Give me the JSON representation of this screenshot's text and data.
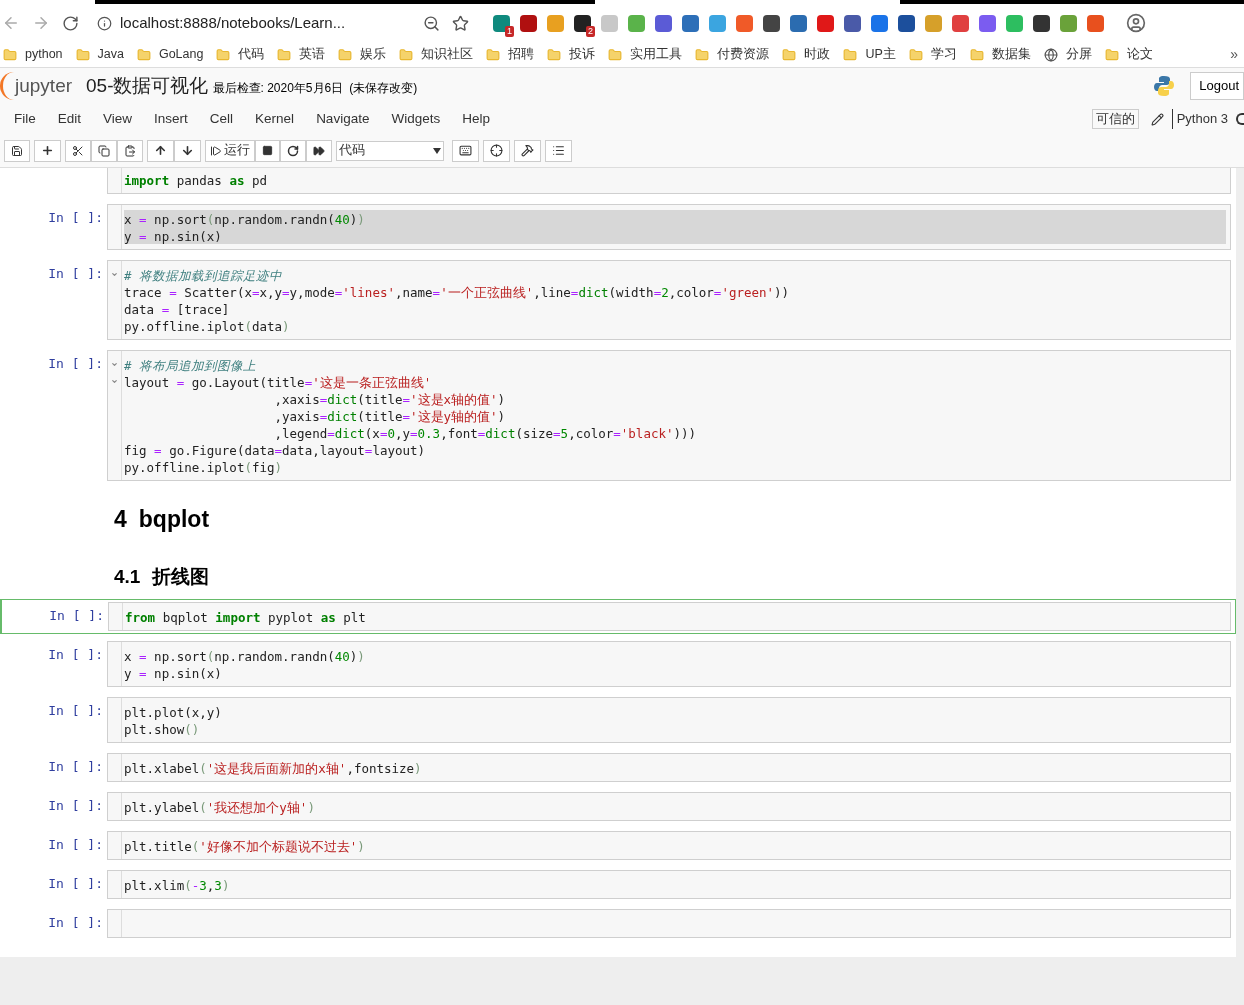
{
  "browser": {
    "url": "localhost:8888/notebooks/Learn...",
    "extensions": [
      {
        "color": "#0f8a7e",
        "badge": "1"
      },
      {
        "color": "#b01010"
      },
      {
        "color": "#e8a020"
      },
      {
        "color": "#222222",
        "badge": "2"
      },
      {
        "color": "#c8c8c8"
      },
      {
        "color": "#5ab34a"
      },
      {
        "color": "#5b5bd6"
      },
      {
        "color": "#2d6fb8"
      },
      {
        "color": "#3ba5e0"
      },
      {
        "color": "#f05a28"
      },
      {
        "color": "#444444"
      },
      {
        "color": "#2b6cb0"
      },
      {
        "color": "#e01818"
      },
      {
        "color": "#4a5aa8"
      },
      {
        "color": "#1a73e8"
      },
      {
        "color": "#1c4f9c"
      },
      {
        "color": "#d6a02a"
      },
      {
        "color": "#e04040"
      },
      {
        "color": "#7b5cf0"
      },
      {
        "color": "#2dbe60"
      },
      {
        "color": "#333333"
      },
      {
        "color": "#6aa23a"
      },
      {
        "color": "#e8501e"
      }
    ],
    "bookmarks": [
      {
        "kind": "folder",
        "label": "python"
      },
      {
        "kind": "folder",
        "label": "Java"
      },
      {
        "kind": "folder",
        "label": "GoLang"
      },
      {
        "kind": "folder",
        "label": "代码"
      },
      {
        "kind": "folder",
        "label": "英语"
      },
      {
        "kind": "folder",
        "label": "娱乐"
      },
      {
        "kind": "folder",
        "label": "知识社区"
      },
      {
        "kind": "folder",
        "label": "招聘"
      },
      {
        "kind": "folder",
        "label": "投诉"
      },
      {
        "kind": "folder",
        "label": "实用工具"
      },
      {
        "kind": "folder",
        "label": "付费资源"
      },
      {
        "kind": "folder",
        "label": "时政"
      },
      {
        "kind": "folder",
        "label": "UP主"
      },
      {
        "kind": "folder",
        "label": "学习"
      },
      {
        "kind": "folder",
        "label": "数据集"
      },
      {
        "kind": "site",
        "label": "分屏"
      },
      {
        "kind": "folder",
        "label": "论文"
      }
    ],
    "more": "»"
  },
  "header": {
    "logo": "jupyter",
    "title": "05-数据可视化",
    "checkpoint": "最后检查: 2020年5月6日",
    "save_status": "(未保存改变)",
    "logout": "Logout"
  },
  "menu": [
    "File",
    "Edit",
    "View",
    "Insert",
    "Cell",
    "Kernel",
    "Navigate",
    "Widgets",
    "Help"
  ],
  "status": {
    "trusted": "可信的",
    "kernel": "Python 3"
  },
  "toolbar": {
    "run_label": "运行",
    "cell_type": "代码"
  },
  "cells": [
    {
      "kind": "code",
      "selected": false,
      "text_selected": false,
      "lines": [
        {
          "fold": false,
          "segs": [
            {
              "kind": "keyword",
              "text": "import"
            },
            {
              "kind": "plain",
              "text": " pandas "
            },
            {
              "kind": "keyword",
              "text": "as"
            },
            {
              "kind": "plain",
              "text": " pd"
            }
          ]
        }
      ]
    },
    {
      "kind": "code",
      "prompt": "In [ ]:",
      "selected": false,
      "text_selected": true,
      "lines": [
        {
          "fold": false,
          "segs": [
            {
              "kind": "plain",
              "text": "x "
            },
            {
              "kind": "operator",
              "text": "="
            },
            {
              "kind": "plain",
              "text": " np.sort"
            },
            {
              "kind": "bracket",
              "text": "("
            },
            {
              "kind": "plain",
              "text": "np.random.randn("
            },
            {
              "kind": "number",
              "text": "40"
            },
            {
              "kind": "plain",
              "text": ")"
            },
            {
              "kind": "bracket",
              "text": ")"
            }
          ]
        },
        {
          "fold": false,
          "segs": [
            {
              "kind": "plain",
              "text": "y "
            },
            {
              "kind": "operator",
              "text": "="
            },
            {
              "kind": "plain",
              "text": " np.sin(x)"
            }
          ]
        }
      ]
    },
    {
      "kind": "code",
      "prompt": "In [ ]:",
      "selected": false,
      "text_selected": false,
      "lines": [
        {
          "fold": true,
          "segs": [
            {
              "kind": "comment",
              "text": "# 将数据加载到追踪足迹中"
            }
          ]
        },
        {
          "fold": false,
          "segs": [
            {
              "kind": "plain",
              "text": "trace "
            },
            {
              "kind": "operator",
              "text": "="
            },
            {
              "kind": "plain",
              "text": " Scatter(x"
            },
            {
              "kind": "operator",
              "text": "="
            },
            {
              "kind": "plain",
              "text": "x,y"
            },
            {
              "kind": "operator",
              "text": "="
            },
            {
              "kind": "plain",
              "text": "y,mode"
            },
            {
              "kind": "operator",
              "text": "="
            },
            {
              "kind": "string",
              "text": "'lines'"
            },
            {
              "kind": "plain",
              "text": ",name"
            },
            {
              "kind": "operator",
              "text": "="
            },
            {
              "kind": "string",
              "text": "'一个正弦曲线'"
            },
            {
              "kind": "plain",
              "text": ",line"
            },
            {
              "kind": "operator",
              "text": "="
            },
            {
              "kind": "builtin",
              "text": "dict"
            },
            {
              "kind": "plain",
              "text": "(width"
            },
            {
              "kind": "operator",
              "text": "="
            },
            {
              "kind": "number",
              "text": "2"
            },
            {
              "kind": "plain",
              "text": ",color"
            },
            {
              "kind": "operator",
              "text": "="
            },
            {
              "kind": "string",
              "text": "'green'"
            },
            {
              "kind": "plain",
              "text": "))"
            }
          ]
        },
        {
          "fold": false,
          "segs": [
            {
              "kind": "plain",
              "text": "data "
            },
            {
              "kind": "operator",
              "text": "="
            },
            {
              "kind": "plain",
              "text": " [trace]"
            }
          ]
        },
        {
          "fold": false,
          "segs": [
            {
              "kind": "plain",
              "text": "py.offline.iplot"
            },
            {
              "kind": "bracket",
              "text": "("
            },
            {
              "kind": "plain",
              "text": "data"
            },
            {
              "kind": "bracket",
              "text": ")"
            }
          ]
        }
      ]
    },
    {
      "kind": "code",
      "prompt": "In [ ]:",
      "selected": false,
      "text_selected": false,
      "lines": [
        {
          "fold": true,
          "segs": [
            {
              "kind": "comment",
              "text": "# 将布局追加到图像上"
            }
          ]
        },
        {
          "fold": true,
          "segs": [
            {
              "kind": "plain",
              "text": "layout "
            },
            {
              "kind": "operator",
              "text": "="
            },
            {
              "kind": "plain",
              "text": " go.Layout(title"
            },
            {
              "kind": "operator",
              "text": "="
            },
            {
              "kind": "string",
              "text": "'这是一条正弦曲线'"
            }
          ]
        },
        {
          "fold": false,
          "segs": [
            {
              "kind": "plain",
              "text": "                    ,xaxis"
            },
            {
              "kind": "operator",
              "text": "="
            },
            {
              "kind": "builtin",
              "text": "dict"
            },
            {
              "kind": "plain",
              "text": "(title"
            },
            {
              "kind": "operator",
              "text": "="
            },
            {
              "kind": "string",
              "text": "'这是x轴的值'"
            },
            {
              "kind": "plain",
              "text": ")"
            }
          ]
        },
        {
          "fold": false,
          "segs": [
            {
              "kind": "plain",
              "text": "                    ,yaxis"
            },
            {
              "kind": "operator",
              "text": "="
            },
            {
              "kind": "builtin",
              "text": "dict"
            },
            {
              "kind": "plain",
              "text": "(title"
            },
            {
              "kind": "operator",
              "text": "="
            },
            {
              "kind": "string",
              "text": "'这是y轴的值'"
            },
            {
              "kind": "plain",
              "text": ")"
            }
          ]
        },
        {
          "fold": false,
          "segs": [
            {
              "kind": "plain",
              "text": "                    ,legend"
            },
            {
              "kind": "operator",
              "text": "="
            },
            {
              "kind": "builtin",
              "text": "dict"
            },
            {
              "kind": "plain",
              "text": "(x"
            },
            {
              "kind": "operator",
              "text": "="
            },
            {
              "kind": "number",
              "text": "0"
            },
            {
              "kind": "plain",
              "text": ",y"
            },
            {
              "kind": "operator",
              "text": "="
            },
            {
              "kind": "number",
              "text": "0.3"
            },
            {
              "kind": "plain",
              "text": ",font"
            },
            {
              "kind": "operator",
              "text": "="
            },
            {
              "kind": "builtin",
              "text": "dict"
            },
            {
              "kind": "plain",
              "text": "(size"
            },
            {
              "kind": "operator",
              "text": "="
            },
            {
              "kind": "number",
              "text": "5"
            },
            {
              "kind": "plain",
              "text": ",color"
            },
            {
              "kind": "operator",
              "text": "="
            },
            {
              "kind": "string",
              "text": "'black'"
            },
            {
              "kind": "plain",
              "text": ")))"
            }
          ]
        },
        {
          "fold": false,
          "segs": [
            {
              "kind": "plain",
              "text": "fig "
            },
            {
              "kind": "operator",
              "text": "="
            },
            {
              "kind": "plain",
              "text": " go.Figure(data"
            },
            {
              "kind": "operator",
              "text": "="
            },
            {
              "kind": "plain",
              "text": "data,layout"
            },
            {
              "kind": "operator",
              "text": "="
            },
            {
              "kind": "plain",
              "text": "layout)"
            }
          ]
        },
        {
          "fold": false,
          "segs": [
            {
              "kind": "plain",
              "text": "py.offline.iplot"
            },
            {
              "kind": "bracket",
              "text": "("
            },
            {
              "kind": "plain",
              "text": "fig"
            },
            {
              "kind": "bracket",
              "text": ")"
            }
          ]
        }
      ]
    },
    {
      "kind": "title",
      "number": "4",
      "text": "bqplot"
    },
    {
      "kind": "subtitle",
      "number": "4.1",
      "text": "折线图"
    },
    {
      "kind": "code",
      "prompt": "In [ ]:",
      "selected": true,
      "text_selected": false,
      "lines": [
        {
          "fold": false,
          "segs": [
            {
              "kind": "keyword",
              "text": "from"
            },
            {
              "kind": "plain",
              "text": " bqplot "
            },
            {
              "kind": "keyword",
              "text": "import"
            },
            {
              "kind": "plain",
              "text": " pyplot "
            },
            {
              "kind": "keyword",
              "text": "as"
            },
            {
              "kind": "plain",
              "text": " plt"
            }
          ]
        }
      ]
    },
    {
      "kind": "code",
      "prompt": "In [ ]:",
      "selected": false,
      "text_selected": false,
      "lines": [
        {
          "fold": false,
          "segs": [
            {
              "kind": "plain",
              "text": "x "
            },
            {
              "kind": "operator",
              "text": "="
            },
            {
              "kind": "plain",
              "text": " np.sort"
            },
            {
              "kind": "bracket",
              "text": "("
            },
            {
              "kind": "plain",
              "text": "np.random.randn("
            },
            {
              "kind": "number",
              "text": "40"
            },
            {
              "kind": "plain",
              "text": ")"
            },
            {
              "kind": "bracket",
              "text": ")"
            }
          ]
        },
        {
          "fold": false,
          "segs": [
            {
              "kind": "plain",
              "text": "y "
            },
            {
              "kind": "operator",
              "text": "="
            },
            {
              "kind": "plain",
              "text": " np.sin(x)"
            }
          ]
        }
      ]
    },
    {
      "kind": "code",
      "prompt": "In [ ]:",
      "selected": false,
      "text_selected": false,
      "lines": [
        {
          "fold": false,
          "segs": [
            {
              "kind": "plain",
              "text": "plt.plot(x,y)"
            }
          ]
        },
        {
          "fold": false,
          "segs": [
            {
              "kind": "plain",
              "text": "plt.show"
            },
            {
              "kind": "bracket",
              "text": "()"
            }
          ]
        }
      ]
    },
    {
      "kind": "code",
      "prompt": "In [ ]:",
      "selected": false,
      "text_selected": false,
      "lines": [
        {
          "fold": false,
          "segs": [
            {
              "kind": "plain",
              "text": "plt.xlabel"
            },
            {
              "kind": "bracket",
              "text": "("
            },
            {
              "kind": "string",
              "text": "'这是我后面新加的x轴'"
            },
            {
              "kind": "plain",
              "text": ",fontsize"
            },
            {
              "kind": "bracket",
              "text": ")"
            }
          ]
        }
      ]
    },
    {
      "kind": "code",
      "prompt": "In [ ]:",
      "selected": false,
      "text_selected": false,
      "lines": [
        {
          "fold": false,
          "segs": [
            {
              "kind": "plain",
              "text": "plt.ylabel"
            },
            {
              "kind": "bracket",
              "text": "("
            },
            {
              "kind": "string",
              "text": "'我还想加个y轴'"
            },
            {
              "kind": "bracket",
              "text": ")"
            }
          ]
        }
      ]
    },
    {
      "kind": "code",
      "prompt": "In [ ]:",
      "selected": false,
      "text_selected": false,
      "lines": [
        {
          "fold": false,
          "segs": [
            {
              "kind": "plain",
              "text": "plt.title"
            },
            {
              "kind": "bracket",
              "text": "("
            },
            {
              "kind": "string",
              "text": "'好像不加个标题说不过去'"
            },
            {
              "kind": "bracket",
              "text": ")"
            }
          ]
        }
      ]
    },
    {
      "kind": "code",
      "prompt": "In [ ]:",
      "selected": false,
      "text_selected": false,
      "lines": [
        {
          "fold": false,
          "segs": [
            {
              "kind": "plain",
              "text": "plt.xlim"
            },
            {
              "kind": "bracket",
              "text": "("
            },
            {
              "kind": "operator",
              "text": "-"
            },
            {
              "kind": "number",
              "text": "3"
            },
            {
              "kind": "plain",
              "text": ","
            },
            {
              "kind": "number",
              "text": "3"
            },
            {
              "kind": "bracket",
              "text": ")"
            }
          ]
        }
      ]
    },
    {
      "kind": "code",
      "prompt": "In [ ]:",
      "selected": false
    }
  ]
}
